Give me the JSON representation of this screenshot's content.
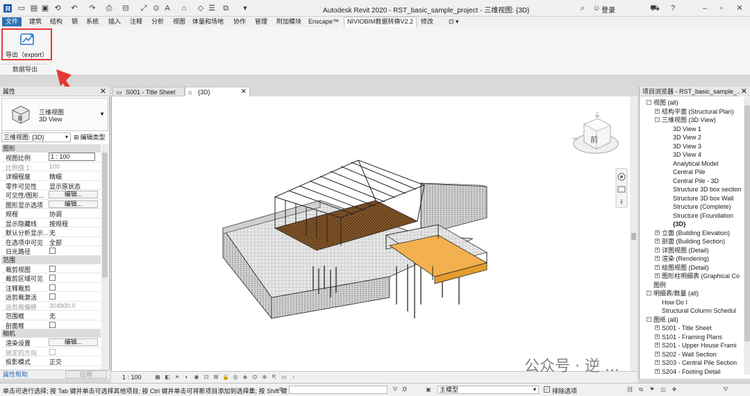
{
  "app": {
    "title": "Autodesk Revit 2020 - RST_basic_sample_project - 三维视图: {3D}",
    "login": "登录"
  },
  "ribbon": {
    "tabs": [
      {
        "label": "文件",
        "kind": "file"
      },
      {
        "label": "建筑"
      },
      {
        "label": "结构"
      },
      {
        "label": "钢"
      },
      {
        "label": "系统"
      },
      {
        "label": "插入"
      },
      {
        "label": "注释"
      },
      {
        "label": "分析"
      },
      {
        "label": "视图"
      },
      {
        "label": "体量和场地"
      },
      {
        "label": "协作"
      },
      {
        "label": "管理"
      },
      {
        "label": "附加模块"
      },
      {
        "label": "Enscape™"
      },
      {
        "label": "NIVIOBIM数据转换V2.2",
        "kind": "active"
      },
      {
        "label": "修改"
      }
    ],
    "export_button": "导出（export）",
    "panel_label": "数据导出",
    "accent": "#e53935"
  },
  "properties": {
    "header": "属性",
    "type_name_cn": "三维视图",
    "type_name_en": "3D View",
    "instance": "三维视图: {3D}",
    "edit_type": "编辑类型",
    "help": "属性帮助",
    "apply": "应用",
    "categories": {
      "graphics": "图形",
      "extents": "范围",
      "camera": "相机"
    },
    "rows": {
      "view_scale": {
        "k": "视图比例",
        "v": "1 : 100"
      },
      "scale_value": {
        "k": "比例值 1:",
        "v": "100"
      },
      "detail_level": {
        "k": "详细程度",
        "v": "精细"
      },
      "parts_visibility": {
        "k": "零件可见性",
        "v": "显示原状态"
      },
      "vis_graphics": {
        "k": "可见性/图形...",
        "v": "编辑..."
      },
      "graphic_display": {
        "k": "图形显示选项",
        "v": "编辑..."
      },
      "discipline": {
        "k": "规程",
        "v": "协调"
      },
      "hidden_lines": {
        "k": "显示隐藏线",
        "v": "按规程"
      },
      "analysis_display": {
        "k": "默认分析显示...",
        "v": "无"
      },
      "show_in": {
        "k": "在选项中可见",
        "v": "全部"
      },
      "sun_path": {
        "k": "日光路径"
      },
      "crop_view": {
        "k": "裁剪视图"
      },
      "crop_visible": {
        "k": "裁剪区域可见"
      },
      "annotation_crop": {
        "k": "注释裁剪"
      },
      "far_clip_active": {
        "k": "远剪裁激活"
      },
      "far_clip_offset": {
        "k": "远剪裁偏移",
        "v": "304800.0"
      },
      "scope_box": {
        "k": "范围框",
        "v": "无"
      },
      "section_box": {
        "k": "剖面框"
      },
      "render_settings": {
        "k": "渲染设置",
        "v": "编辑..."
      },
      "locked_orientation": {
        "k": "锁定的方向"
      },
      "projection_mode": {
        "k": "投影模式",
        "v": "正交"
      }
    }
  },
  "view_tabs": [
    {
      "label": "S001 - Title Sheet",
      "active": false
    },
    {
      "label": "{3D}",
      "active": true
    }
  ],
  "viewbar": {
    "scale": "1 : 100"
  },
  "browser": {
    "header": "项目浏览器 - RST_basic_sample_...",
    "items": [
      {
        "label": "视图 (all)",
        "level": 0,
        "exp": "-"
      },
      {
        "label": "结构平面 (Structural Plan)",
        "level": 1,
        "exp": "+"
      },
      {
        "label": "三维视图 (3D View)",
        "level": 1,
        "exp": "-"
      },
      {
        "label": "3D View 1",
        "level": 2
      },
      {
        "label": "3D View 2",
        "level": 2
      },
      {
        "label": "3D View 3",
        "level": 2
      },
      {
        "label": "3D View 4",
        "level": 2
      },
      {
        "label": "Analytical Model",
        "level": 2
      },
      {
        "label": "Central Pile",
        "level": 2
      },
      {
        "label": "Central Pile - 3D",
        "level": 2
      },
      {
        "label": "Structure 3D box section",
        "level": 2
      },
      {
        "label": "Structure 3D box Wall",
        "level": 2
      },
      {
        "label": "Structure (Complete)",
        "level": 2
      },
      {
        "label": "Structure (Foundation",
        "level": 2
      },
      {
        "label": "{3D}",
        "level": 2,
        "bold": true
      },
      {
        "label": "立面 (Building Elevation)",
        "level": 1,
        "exp": "+"
      },
      {
        "label": "剖面 (Building Section)",
        "level": 1,
        "exp": "+"
      },
      {
        "label": "详图视图 (Detail)",
        "level": 1,
        "exp": "+"
      },
      {
        "label": "渲染 (Rendering)",
        "level": 1,
        "exp": "+"
      },
      {
        "label": "绘图视图 (Detail)",
        "level": 1,
        "exp": "+"
      },
      {
        "label": "图形柱明细表 (Graphical Co",
        "level": 1,
        "exp": "+"
      },
      {
        "label": "图例",
        "level": 0
      },
      {
        "label": "明细表/数量 (all)",
        "level": 0,
        "exp": "-"
      },
      {
        "label": "How Do I",
        "level": 1
      },
      {
        "label": "Structural Column Schedul",
        "level": 1
      },
      {
        "label": "图纸 (all)",
        "level": 0,
        "exp": "-"
      },
      {
        "label": "S001 - Title Sheet",
        "level": 1,
        "exp": "+"
      },
      {
        "label": "S101 - Framing Plans",
        "level": 1,
        "exp": "+"
      },
      {
        "label": "S201 - Upper House Frami",
        "level": 1,
        "exp": "+"
      },
      {
        "label": "S202 - Wall Section",
        "level": 1,
        "exp": "+"
      },
      {
        "label": "S203 - Central Pile Section",
        "level": 1,
        "exp": "+"
      },
      {
        "label": "S204 - Footing Detail",
        "level": 1,
        "exp": "+"
      }
    ]
  },
  "status": {
    "hint": "单击可进行选择; 按 Tab 键并单击可选择其他项目; 按 Ctrl 键并单击可将新项目添加到选择集; 按 Shift 键",
    "count": ":0",
    "model": "主模型",
    "exclude": "排除选项"
  },
  "viewcube": {
    "face": "前"
  },
  "watermark": "公众号 · 逆 ..."
}
